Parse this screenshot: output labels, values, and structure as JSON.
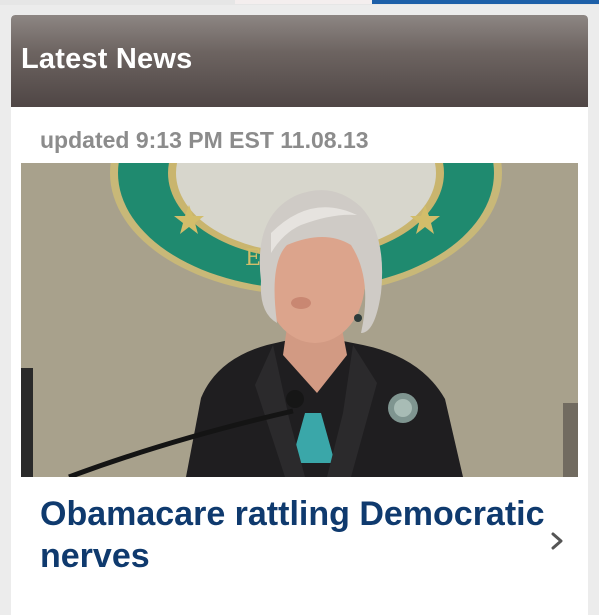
{
  "section": {
    "title": "Latest News"
  },
  "article": {
    "updated": "updated 9:13 PM EST 11.08.13",
    "headline": "Obamacare rattling Democratic nerves",
    "seal_letter": "E",
    "image": "news-photo"
  },
  "colors": {
    "header": "#6d6461",
    "headline": "#0f3a6e",
    "updated": "#8c8c8c",
    "accent": "#1d5fa8"
  },
  "icons": {
    "more": "chevron-right-icon"
  }
}
